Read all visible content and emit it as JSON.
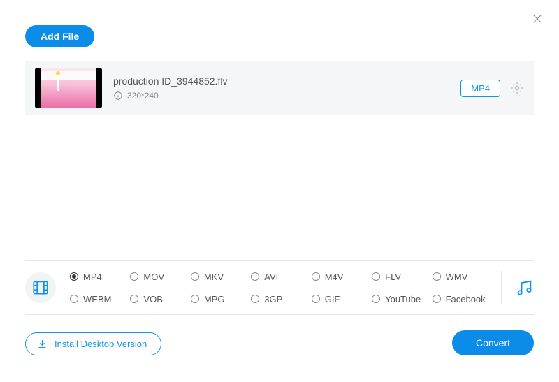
{
  "buttons": {
    "add_file": "Add File",
    "install": "Install Desktop Version",
    "convert": "Convert"
  },
  "file": {
    "name": "production ID_3944852.flv",
    "resolution": "320*240",
    "target_format": "MP4"
  },
  "formats": {
    "selected": "MP4",
    "row1": [
      "MP4",
      "MOV",
      "MKV",
      "AVI",
      "M4V",
      "FLV",
      "WMV"
    ],
    "row2": [
      "WEBM",
      "VOB",
      "MPG",
      "3GP",
      "GIF",
      "YouTube",
      "Facebook"
    ]
  },
  "colors": {
    "accent": "#0b8ce8",
    "accent_border": "#1095ec"
  }
}
